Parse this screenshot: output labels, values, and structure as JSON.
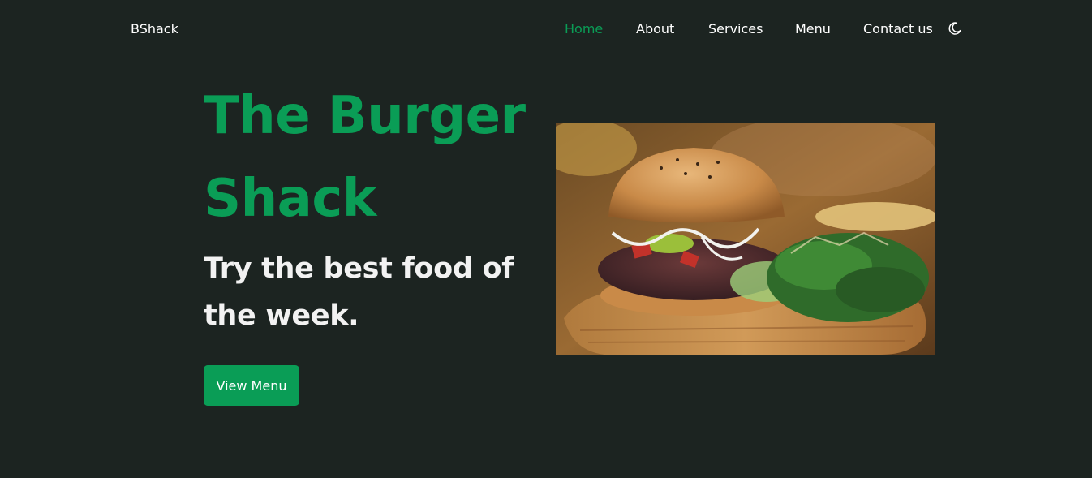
{
  "nav": {
    "brand": "BShack",
    "items": [
      {
        "label": "Home",
        "active": true
      },
      {
        "label": "About",
        "active": false
      },
      {
        "label": "Services",
        "active": false
      },
      {
        "label": "Menu",
        "active": false
      },
      {
        "label": "Contact us",
        "active": false
      }
    ],
    "theme_toggle_icon": "moon-icon"
  },
  "hero": {
    "title": "The Burger Shack",
    "subtitle": "Try the best food of the week.",
    "cta_label": "View Menu",
    "image_icon": "burger-photo"
  },
  "colors": {
    "background": "#1c2421",
    "accent": "#0a9d56",
    "text": "#ffffff"
  }
}
